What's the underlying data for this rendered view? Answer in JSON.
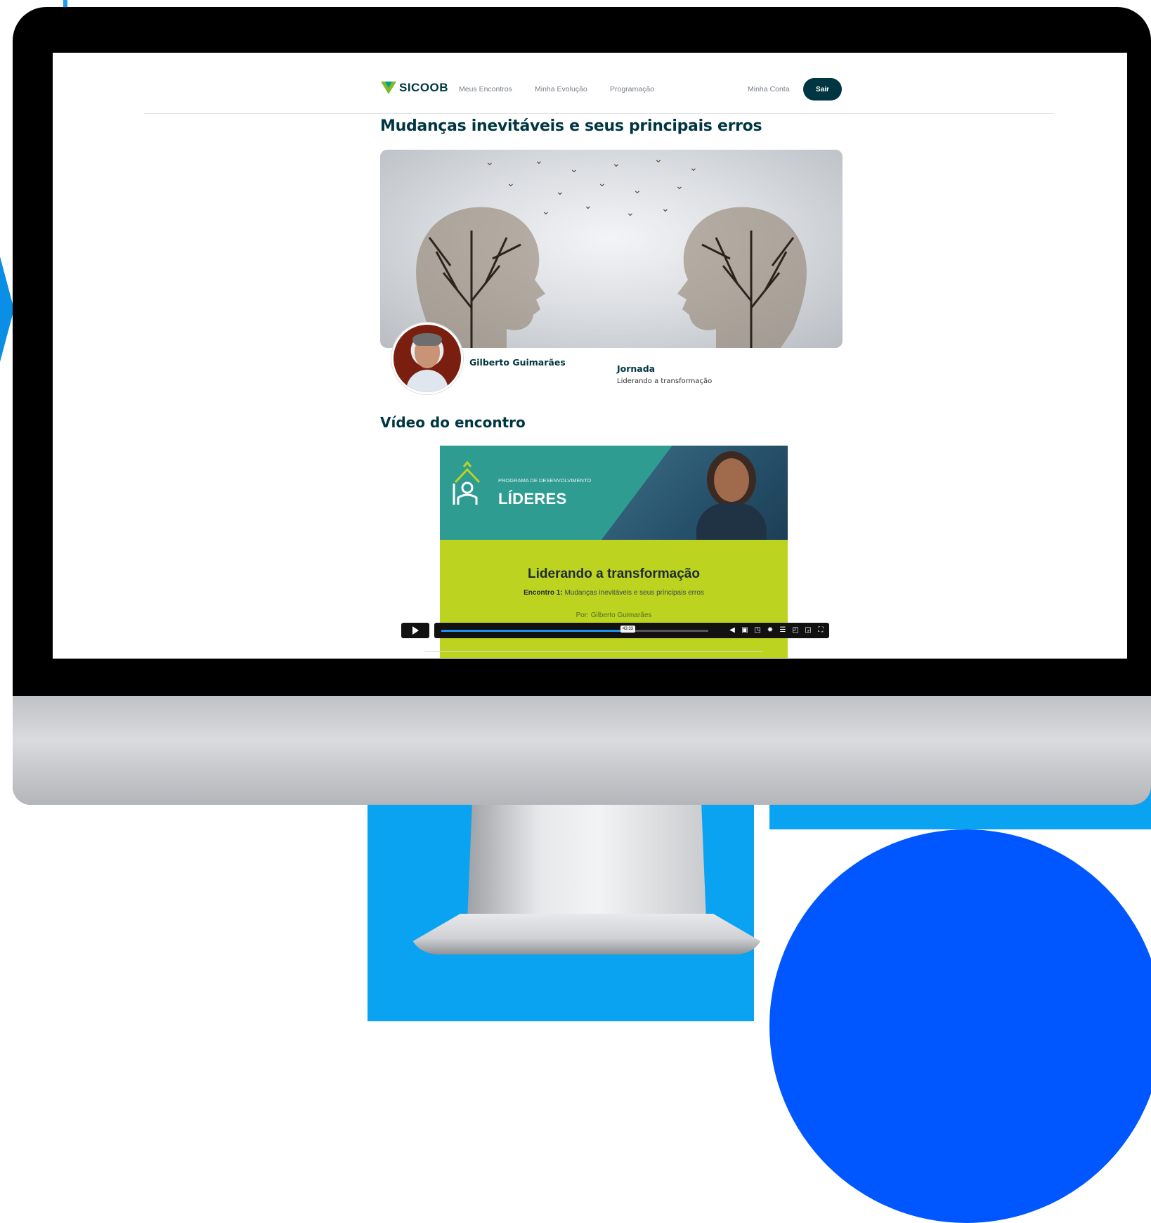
{
  "nav": {
    "logo_text": "SICOOB",
    "links": [
      "Meus Encontros",
      "Minha Evolução",
      "Programação"
    ],
    "account": "Minha Conta",
    "logout": "Sair"
  },
  "page": {
    "title": "Mudanças inevitáveis e seus principais erros"
  },
  "speaker": {
    "name": "Gilberto Guimarães",
    "jornada_label": "Jornada",
    "jornada_value": "Liderando a transformação"
  },
  "video": {
    "heading": "Vídeo do encontro",
    "slide": {
      "program_small": "PROGRAMA DE DESENVOLVIMENTO",
      "program_big": "LÍDERES",
      "title": "Liderando a transformação",
      "subtitle_bold": "Encontro 1:",
      "subtitle_rest": " Mudanças inevitáveis e seus principais erros",
      "author": "Por: Gilberto Guimarães"
    },
    "player": {
      "time_tooltip": "43:33",
      "progress": 0.69,
      "icons": [
        "volume-icon",
        "captions-icon",
        "picture-in-picture-icon",
        "settings-icon",
        "chapters-icon",
        "cast-icon",
        "miniplayer-icon",
        "fullscreen-icon"
      ]
    }
  },
  "colors": {
    "brand_dark": "#003641",
    "brand_green": "#7db928",
    "slide_teal": "#2f9c92",
    "slide_lime": "#bcd31f",
    "background_blue": "#0aa3f2",
    "background_circle": "#0057ff"
  }
}
